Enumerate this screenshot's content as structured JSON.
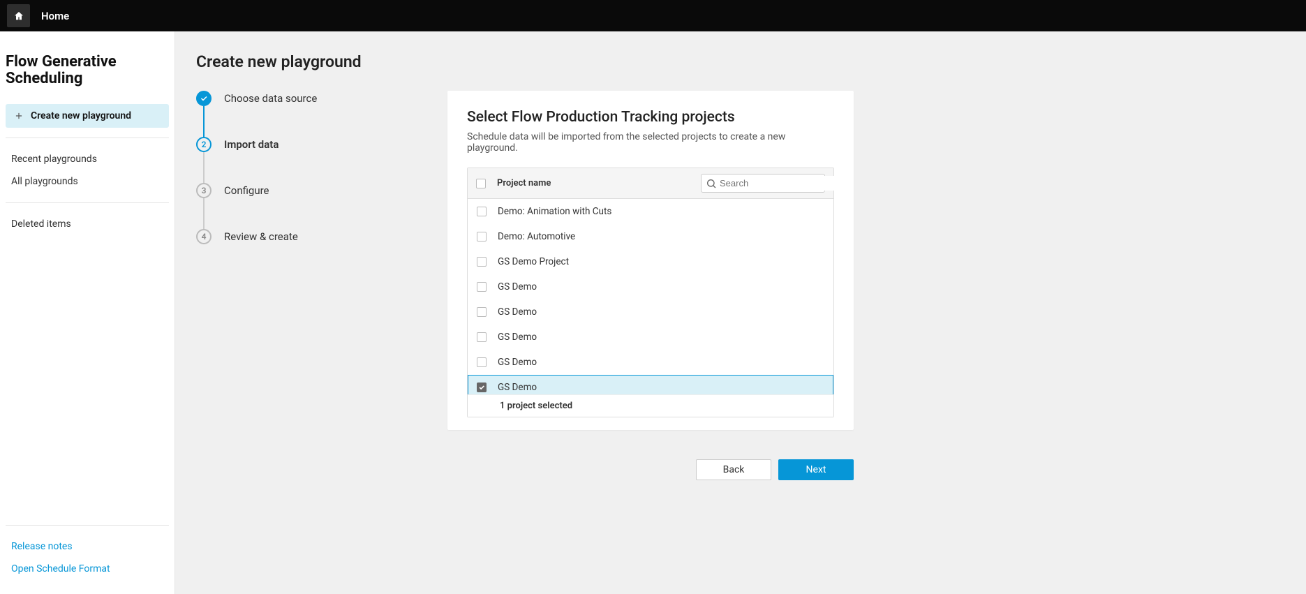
{
  "topbar": {
    "home_label": "Home"
  },
  "sidebar": {
    "app_title_line1": "Flow Generative",
    "app_title_line2": "Scheduling",
    "create_label": "Create new playground",
    "nav_recent": "Recent playgrounds",
    "nav_all": "All playgrounds",
    "nav_deleted": "Deleted items",
    "footer_release": "Release notes",
    "footer_osf": "Open Schedule Format"
  },
  "main": {
    "page_title": "Create new playground",
    "steps": [
      {
        "num": "1",
        "label": "Choose data source",
        "state": "done"
      },
      {
        "num": "2",
        "label": "Import data",
        "state": "current"
      },
      {
        "num": "3",
        "label": "Configure",
        "state": "pending"
      },
      {
        "num": "4",
        "label": "Review & create",
        "state": "pending"
      }
    ],
    "card": {
      "title": "Select Flow Production Tracking projects",
      "subtitle": "Schedule data will be imported from the selected projects to create a new playground.",
      "col_label": "Project name",
      "search_placeholder": "Search",
      "rows": [
        {
          "name": "Demo: Animation with Cuts",
          "checked": false
        },
        {
          "name": "Demo: Automotive",
          "checked": false
        },
        {
          "name": "GS Demo Project",
          "checked": false
        },
        {
          "name": "GS Demo",
          "checked": false
        },
        {
          "name": "GS Demo",
          "checked": false
        },
        {
          "name": "GS Demo",
          "checked": false
        },
        {
          "name": "GS Demo",
          "checked": false
        },
        {
          "name": "GS Demo",
          "checked": true
        }
      ],
      "footer": "1 project selected"
    },
    "actions": {
      "back": "Back",
      "next": "Next"
    }
  }
}
